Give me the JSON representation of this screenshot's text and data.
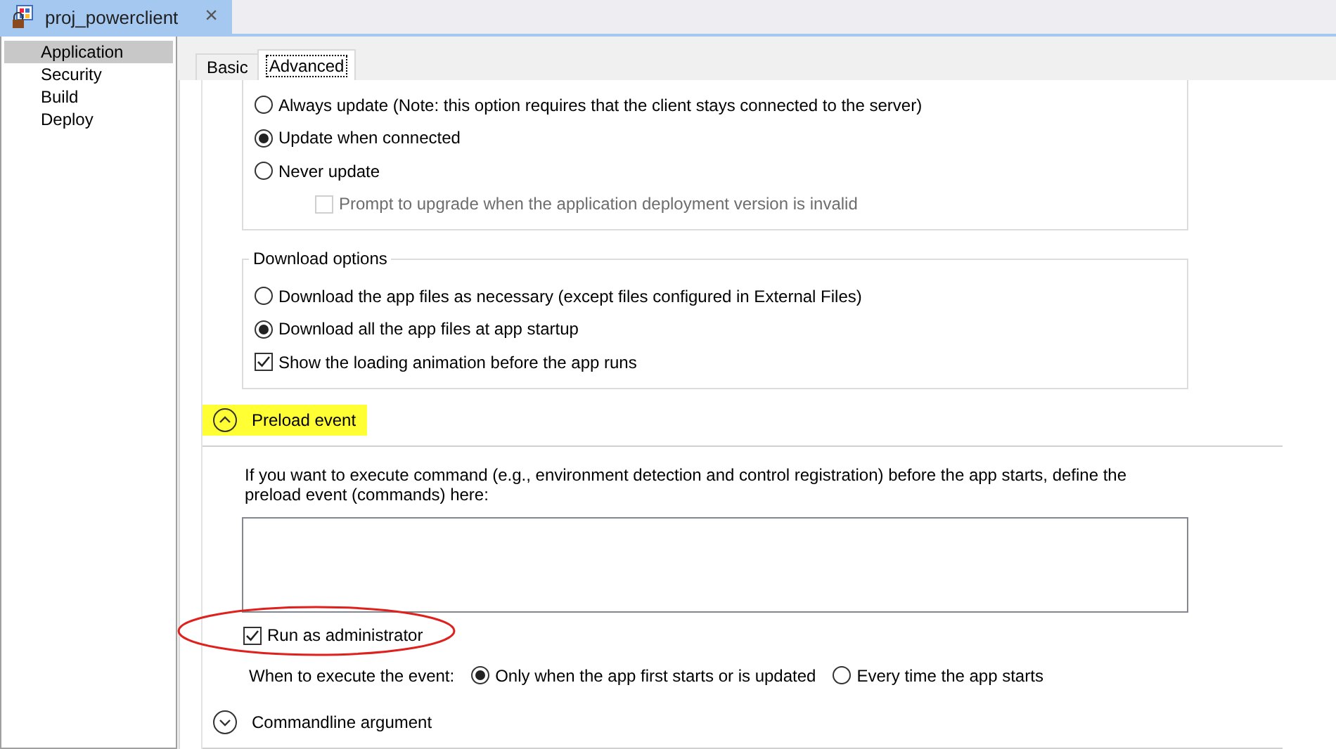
{
  "document_tab": {
    "title": "proj_powerclient",
    "close": "×"
  },
  "sidebar": {
    "items": [
      {
        "label": "Application",
        "selected": true
      },
      {
        "label": "Security",
        "selected": false
      },
      {
        "label": "Build",
        "selected": false
      },
      {
        "label": "Deploy",
        "selected": false
      }
    ]
  },
  "tabs": [
    {
      "label": "Basic",
      "selected": false
    },
    {
      "label": "Advanced",
      "selected": true
    }
  ],
  "update_group": {
    "options": [
      {
        "kind": "radio",
        "label": "Always update (Note: this option requires that the client stays connected to the server)",
        "checked": false,
        "disabled": false
      },
      {
        "kind": "radio",
        "label": "Update when connected",
        "checked": true,
        "disabled": false
      },
      {
        "kind": "radio",
        "label": "Never update",
        "checked": false,
        "disabled": false
      },
      {
        "kind": "checkbox",
        "label": "Prompt to upgrade when the application deployment version is invalid",
        "checked": false,
        "disabled": true
      }
    ]
  },
  "download_group": {
    "legend": "Download options",
    "options": [
      {
        "kind": "radio",
        "label": "Download the app files as necessary (except files configured in External Files)",
        "checked": false,
        "disabled": false
      },
      {
        "kind": "radio",
        "label": "Download all the app files at app startup",
        "checked": true,
        "disabled": false
      },
      {
        "kind": "checkbox",
        "label": "Show the loading animation before the app runs",
        "checked": true,
        "disabled": false
      }
    ]
  },
  "preload_section": {
    "title": "Preload event",
    "expanded": true,
    "highlighted": true,
    "description": "If you want to execute command (e.g., environment detection and control registration) before the app starts, define the preload event (commands) here:",
    "run_as_admin": {
      "label": "Run as administrator",
      "checked": true,
      "annotated": true
    },
    "when": {
      "label": "When to execute the event:",
      "options": [
        {
          "label": "Only when the app first starts or is updated",
          "selected": true
        },
        {
          "label": "Every time the app starts",
          "selected": false
        }
      ]
    }
  },
  "commandline_section": {
    "title": "Commandline argument",
    "expanded": false,
    "highlighted": false
  }
}
